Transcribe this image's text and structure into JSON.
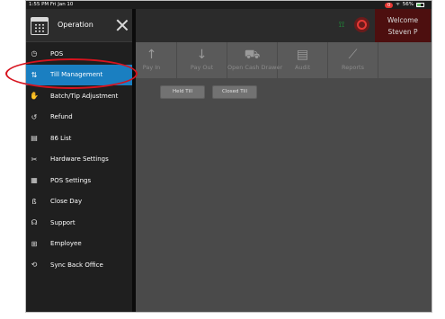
{
  "status": {
    "time": "1:55 PM  Fri Jan 10",
    "badge": "0",
    "wifi": "ᯤ",
    "battery": "56%"
  },
  "header": {
    "welcome": "Welcome",
    "user": "Steven P"
  },
  "toolbar": {
    "items": [
      {
        "label": "Pay In",
        "icon": "↑"
      },
      {
        "label": "Pay Out",
        "icon": "↓"
      },
      {
        "label": "Open Cash Drawer",
        "icon": "⛟"
      },
      {
        "label": "Audit",
        "icon": "▤"
      },
      {
        "label": "Reports",
        "icon": "⟋"
      }
    ]
  },
  "tabs": {
    "held": "Held Till",
    "closed": "Closed Till"
  },
  "drawer": {
    "title": "Operation",
    "items": [
      {
        "label": "POS",
        "icon": "◷"
      },
      {
        "label": "Till Management",
        "icon": "⇅"
      },
      {
        "label": "Batch/Tip Adjustment",
        "icon": "✋"
      },
      {
        "label": "Refund",
        "icon": "↺"
      },
      {
        "label": "86 List",
        "icon": "▤"
      },
      {
        "label": "Hardware Settings",
        "icon": "✂"
      },
      {
        "label": "POS Settings",
        "icon": "▦"
      },
      {
        "label": "Close Day",
        "icon": "ß"
      },
      {
        "label": "Support",
        "icon": "☊"
      },
      {
        "label": "Employee",
        "icon": "⊞"
      },
      {
        "label": "Sync Back Office",
        "icon": "⟲"
      }
    ]
  },
  "colors": {
    "accent": "#1a7fc1",
    "highlight_ring": "#d7131e"
  }
}
